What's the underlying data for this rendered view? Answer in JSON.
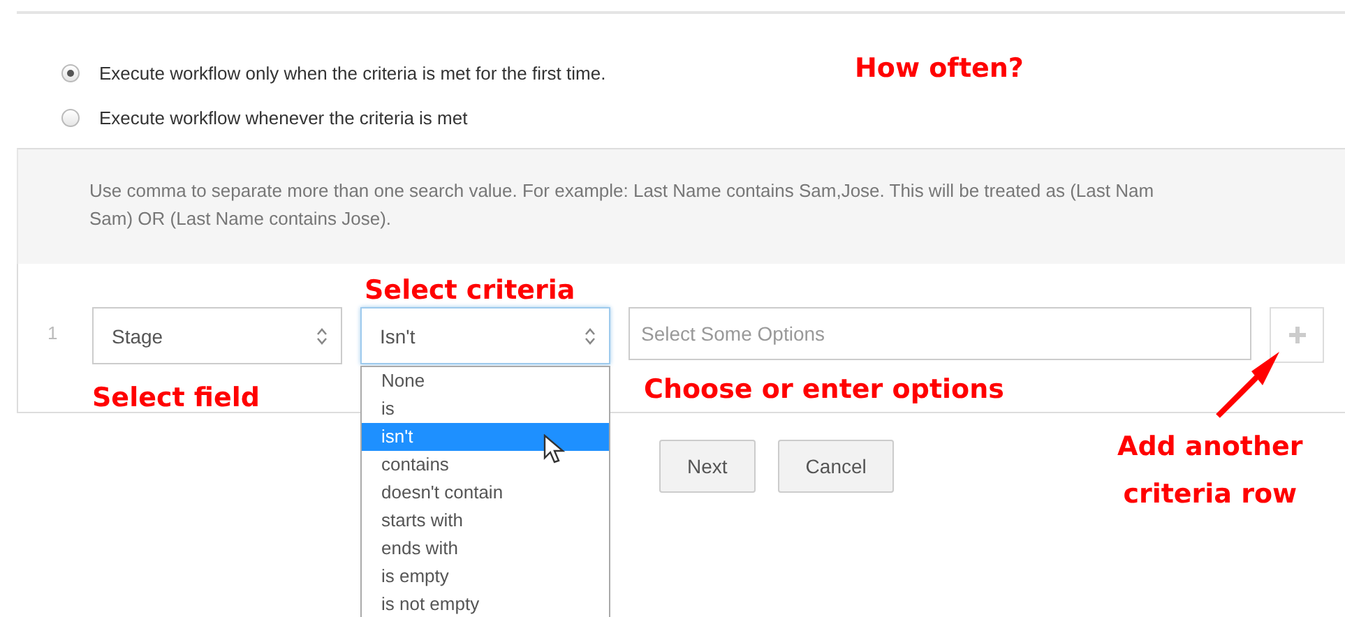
{
  "frequency_options": [
    {
      "label": "Execute workflow only when the criteria is met for the first time.",
      "selected": true
    },
    {
      "label": "Execute workflow whenever the criteria is met",
      "selected": false
    }
  ],
  "hint_lines": [
    "Use comma to separate more than one search value. For example: Last Name contains Sam,Jose. This will be treated as (Last Nam",
    "Sam) OR (Last Name contains Jose)."
  ],
  "criteria_rows": [
    {
      "number": "1",
      "field": "Stage",
      "operator": "Isn't",
      "options_placeholder": "Select Some Options"
    }
  ],
  "operator_dropdown": {
    "items": [
      {
        "label": "None",
        "selected": false
      },
      {
        "label": "is",
        "selected": false
      },
      {
        "label": "isn't",
        "selected": true
      },
      {
        "label": "contains",
        "selected": false
      },
      {
        "label": "doesn't contain",
        "selected": false
      },
      {
        "label": "starts with",
        "selected": false
      },
      {
        "label": "ends with",
        "selected": false
      },
      {
        "label": "is empty",
        "selected": false
      },
      {
        "label": "is not empty",
        "selected": false
      }
    ]
  },
  "buttons": [
    "Next",
    "Cancel"
  ],
  "annotations": [
    {
      "kind": "how-often",
      "lines": [
        "How often?"
      ]
    },
    {
      "kind": "select-criteria",
      "lines": [
        "Select criteria"
      ]
    },
    {
      "kind": "select-field",
      "lines": [
        "Select field"
      ]
    },
    {
      "kind": "choose-options",
      "lines": [
        "Choose or enter options"
      ]
    },
    {
      "kind": "add-row",
      "lines": [
        "Add another",
        "criteria row"
      ]
    }
  ]
}
